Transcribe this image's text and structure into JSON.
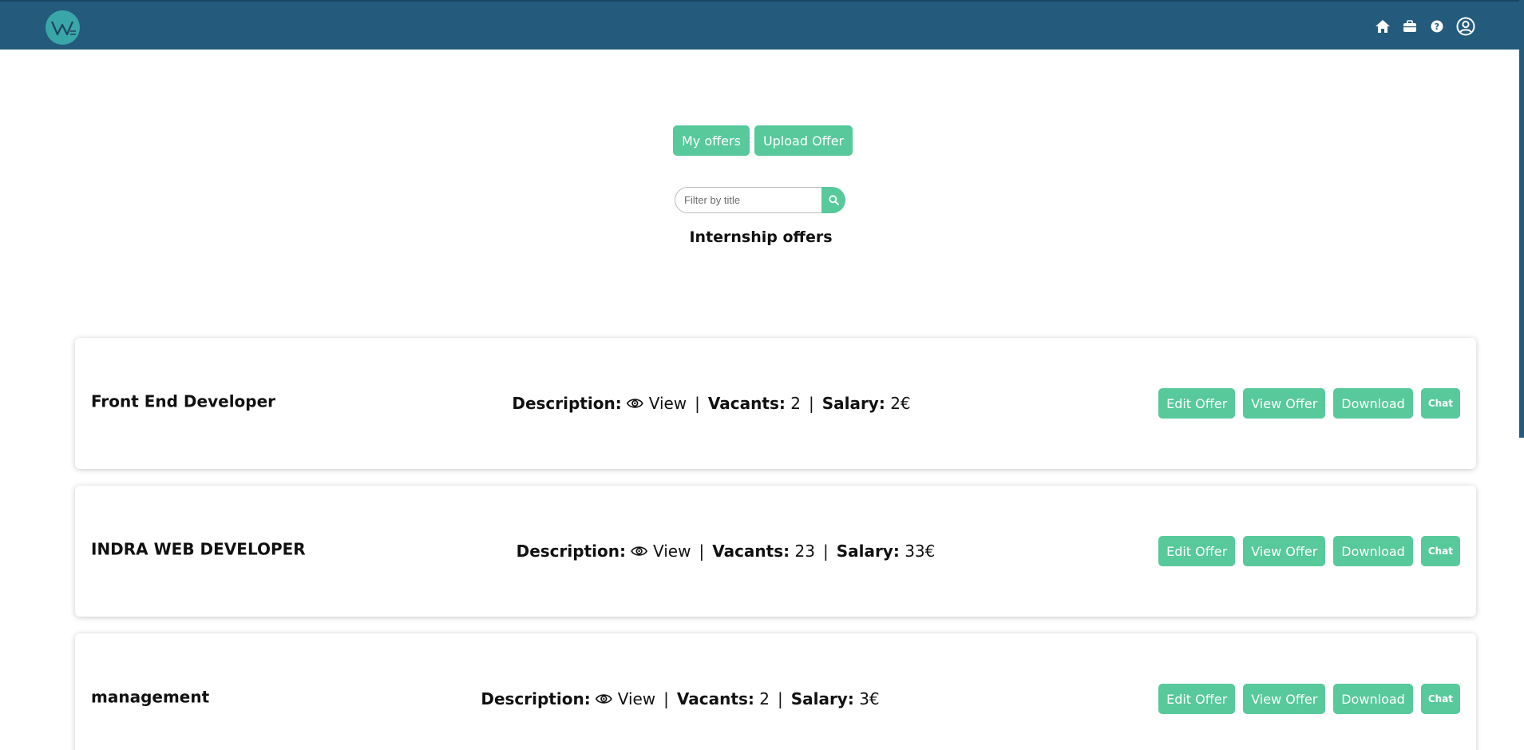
{
  "header": {
    "logo_text": "W",
    "nav": [
      {
        "name": "home-icon"
      },
      {
        "name": "briefcase-icon"
      },
      {
        "name": "help-icon"
      },
      {
        "name": "user-icon"
      }
    ],
    "colors": {
      "bar": "#245a7c",
      "accent": "#57c99b"
    }
  },
  "tabs": {
    "my_offers": "My offers",
    "upload_offer": "Upload Offer"
  },
  "search": {
    "placeholder": "Filter by title"
  },
  "section_title": "Internship offers",
  "labels": {
    "description": "Description:",
    "view": "View",
    "vacants": "Vacants:",
    "salary": "Salary:",
    "separator": "|"
  },
  "offers": [
    {
      "title": "Front End Developer",
      "vacants": "2",
      "salary": "2€"
    },
    {
      "title": "INDRA WEB DEVELOPER",
      "vacants": "23",
      "salary": "33€"
    },
    {
      "title": "management",
      "vacants": "2",
      "salary": "3€"
    }
  ],
  "actions": {
    "edit": "Edit Offer",
    "view": "View Offer",
    "download": "Download",
    "chat": "Chat"
  }
}
